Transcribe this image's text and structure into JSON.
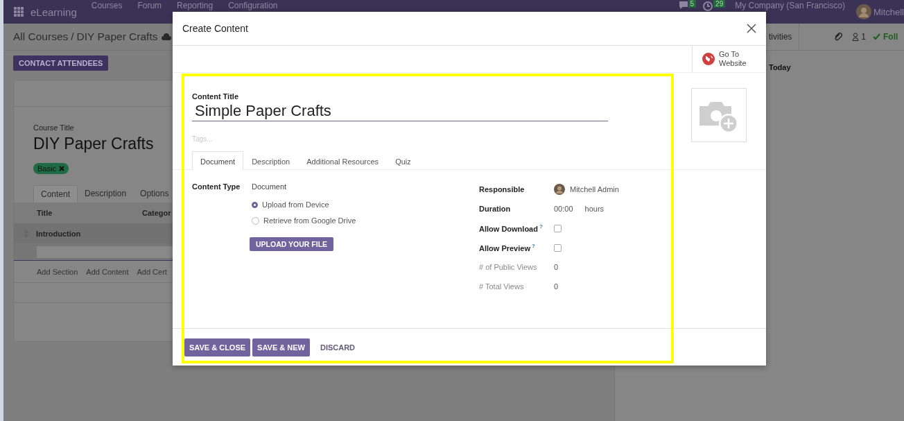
{
  "navbar": {
    "app_name": "eLearning",
    "menu": [
      "Courses",
      "Forum",
      "Reporting",
      "Configuration"
    ],
    "messages_count": "5",
    "activities_count": "29",
    "company": "My Company (San Francisco)",
    "user": "Mitchell"
  },
  "breadcrumb": {
    "parent": "All Courses",
    "separator": "/",
    "current": "DIY Paper Crafts"
  },
  "actions": [
    "CONTACT ATTENDEES"
  ],
  "chatter": {
    "tab": "tivities",
    "followers": "1",
    "follow": "Foll",
    "date_header": "Today"
  },
  "course_form": {
    "title_label": "Course Title",
    "title": "DIY Paper Crafts",
    "tags": [
      "Basic"
    ],
    "tabs": [
      {
        "label": "Content",
        "selected": true
      },
      {
        "label": "Description",
        "selected": false
      },
      {
        "label": "Options",
        "selected": false
      }
    ],
    "columns": [
      "Title",
      "Categor"
    ],
    "section_rows": [
      "Introduction"
    ],
    "add_links": [
      "Add Section",
      "Add Content",
      "Add Cert"
    ]
  },
  "dialog": {
    "title": "Create Content",
    "website_button": "Go To Website",
    "content_title_label": "Content Title",
    "content_title": "Simple Paper Crafts",
    "tags_placeholder": "Tags...",
    "tabs": [
      {
        "label": "Document",
        "selected": true
      },
      {
        "label": "Description",
        "selected": false
      },
      {
        "label": "Additional Resources",
        "selected": false
      },
      {
        "label": "Quiz",
        "selected": false
      }
    ],
    "content_type": {
      "label": "Content Type",
      "value": "Document"
    },
    "source_options": [
      {
        "label": "Upload from Device",
        "selected": true
      },
      {
        "label": "Retrieve from Google Drive",
        "selected": false
      }
    ],
    "upload_button": "UPLOAD YOUR FILE",
    "fields": [
      {
        "kind": "user",
        "label": "Responsible",
        "value": "Mitchell Admin"
      },
      {
        "kind": "duration",
        "label": "Duration",
        "value": "00:00",
        "unit": "hours"
      },
      {
        "kind": "checkbox",
        "label": "Allow Download",
        "help": "?",
        "checked": false
      },
      {
        "kind": "checkbox",
        "label": "Allow Preview",
        "help": "?",
        "checked": false
      },
      {
        "kind": "stat",
        "label": "# of Public Views",
        "value": "0"
      },
      {
        "kind": "stat",
        "label": "# Total Views",
        "value": "0"
      }
    ],
    "footer_buttons": [
      {
        "label": "SAVE & CLOSE",
        "kind": "primary"
      },
      {
        "label": "SAVE & NEW",
        "kind": "primary"
      },
      {
        "label": "DISCARD",
        "kind": "link"
      }
    ]
  }
}
